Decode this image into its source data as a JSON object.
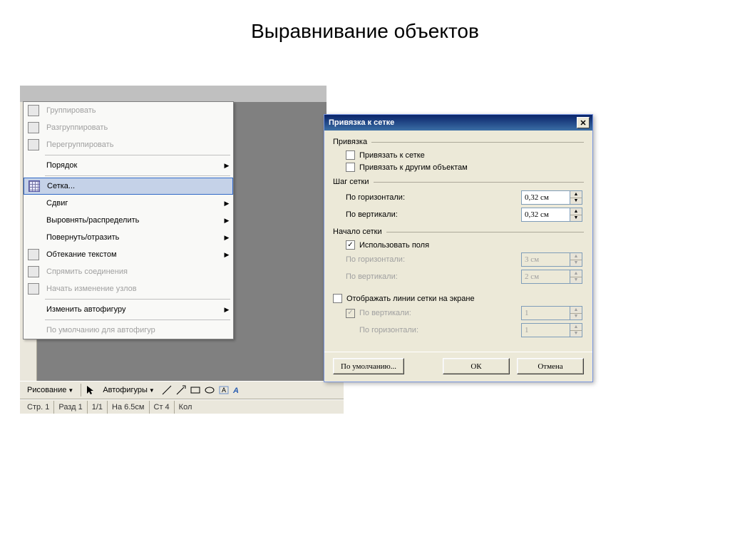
{
  "page": {
    "title": "Выравнивание объектов"
  },
  "menu": {
    "items": [
      {
        "label": "Группировать",
        "icon": "group-icon",
        "disabled": true,
        "submenu": false
      },
      {
        "label": "Разгруппировать",
        "icon": "ungroup-icon",
        "disabled": true,
        "submenu": false
      },
      {
        "label": "Перегруппировать",
        "icon": "regroup-icon",
        "disabled": true,
        "submenu": false
      },
      {
        "sep": true
      },
      {
        "label": "Порядок",
        "icon": "",
        "disabled": false,
        "submenu": true
      },
      {
        "sep": true
      },
      {
        "label": "Сетка...",
        "icon": "grid-icon",
        "disabled": false,
        "submenu": false,
        "highlighted": true
      },
      {
        "label": "Сдвиг",
        "icon": "",
        "disabled": false,
        "submenu": true
      },
      {
        "label": "Выровнять/распределить",
        "icon": "",
        "disabled": false,
        "submenu": true
      },
      {
        "label": "Повернуть/отразить",
        "icon": "",
        "disabled": false,
        "submenu": true
      },
      {
        "label": "Обтекание текстом",
        "icon": "wrap-icon",
        "disabled": false,
        "submenu": true
      },
      {
        "label": "Спрямить соединения",
        "icon": "straighten-icon",
        "disabled": true,
        "submenu": false
      },
      {
        "label": "Начать изменение узлов",
        "icon": "nodes-icon",
        "disabled": true,
        "submenu": false
      },
      {
        "sep": true
      },
      {
        "label": "Изменить автофигуру",
        "icon": "",
        "disabled": false,
        "submenu": true
      },
      {
        "sep": true
      },
      {
        "label": "По умолчанию для автофигур",
        "icon": "",
        "disabled": true,
        "submenu": false
      }
    ]
  },
  "toolbar": {
    "drawing_label": "Рисование",
    "autoshapes_label": "Автофигуры"
  },
  "status": {
    "page": "Стр. 1",
    "section": "Разд 1",
    "pages": "1/1",
    "at": "На 6.5см",
    "col": "Ст 4",
    "extra": "Кол"
  },
  "dialog": {
    "title": "Привязка к сетке",
    "snap": {
      "label": "Привязка",
      "to_grid_label": "Привязать к сетке",
      "to_grid_checked": false,
      "to_objects_label": "Привязать к другим объектам",
      "to_objects_checked": false
    },
    "step": {
      "label": "Шаг сетки",
      "h_label": "По горизонтали:",
      "h_value": "0,32 см",
      "v_label": "По вертикали:",
      "v_value": "0,32 см"
    },
    "origin": {
      "label": "Начало сетки",
      "use_margins_label": "Использовать поля",
      "use_margins_checked": true,
      "h_label": "По горизонтали:",
      "h_value": "3 см",
      "v_label": "По вертикали:",
      "v_value": "2 см"
    },
    "display": {
      "show_label": "Отображать линии сетки на экране",
      "show_checked": false,
      "v_label": "По вертикали:",
      "v_value": "1",
      "v_checked": true,
      "h_label": "По горизонтали:",
      "h_value": "1"
    },
    "buttons": {
      "default": "По умолчанию...",
      "ok": "ОК",
      "cancel": "Отмена"
    }
  }
}
